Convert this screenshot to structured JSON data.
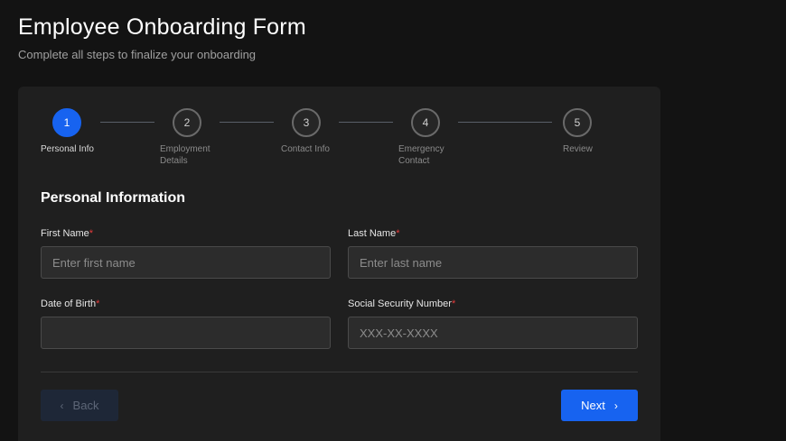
{
  "header": {
    "title": "Employee Onboarding Form",
    "subtitle": "Complete all steps to finalize your onboarding"
  },
  "stepper": {
    "steps": [
      {
        "number": "1",
        "label": "Personal Info",
        "active": true
      },
      {
        "number": "2",
        "label": "Employment Details",
        "active": false
      },
      {
        "number": "3",
        "label": "Contact Info",
        "active": false
      },
      {
        "number": "4",
        "label": "Emergency Contact",
        "active": false
      },
      {
        "number": "5",
        "label": "Review",
        "active": false
      }
    ]
  },
  "form": {
    "section_title": "Personal Information",
    "required_marker": "*",
    "fields": {
      "first_name": {
        "label": "First Name",
        "placeholder": "Enter first name",
        "value": ""
      },
      "last_name": {
        "label": "Last Name",
        "placeholder": "Enter last name",
        "value": ""
      },
      "dob": {
        "label": "Date of Birth",
        "placeholder": "",
        "value": ""
      },
      "ssn": {
        "label": "Social Security Number",
        "placeholder": "XXX-XX-XXXX",
        "value": ""
      }
    }
  },
  "actions": {
    "back_label": "Back",
    "next_label": "Next",
    "back_icon": "chevron-left-icon",
    "next_icon": "chevron-right-icon"
  },
  "colors": {
    "accent": "#1763f0",
    "background": "#131313",
    "card": "#1f1f1f",
    "required": "#e53b3b"
  }
}
